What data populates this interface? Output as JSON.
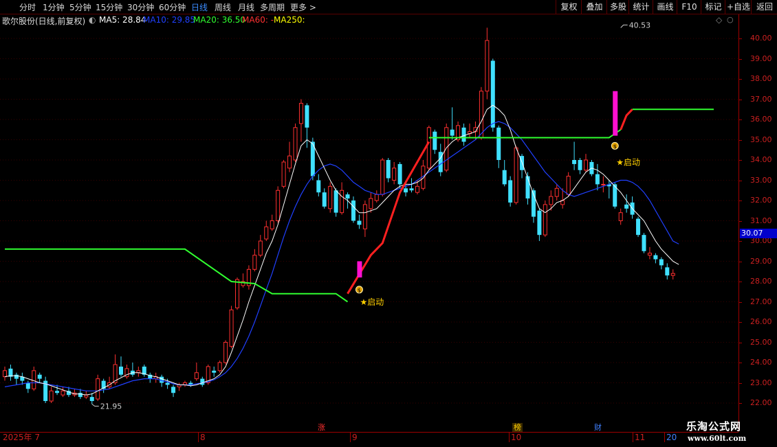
{
  "toolbar": {
    "periods": [
      "分时",
      "1分钟",
      "5分钟",
      "15分钟",
      "30分钟",
      "60分钟",
      "日线",
      "周线",
      "月线",
      "多周期",
      "更多 >"
    ],
    "active_period": "日线",
    "right_buttons": [
      "复权",
      "叠加",
      "多股",
      "统计",
      "画线",
      "F10",
      "标记",
      "+自选",
      "返回"
    ]
  },
  "stock_info": {
    "title": "歌尔股份(日线,前复权)",
    "ma5": "MA5: 28.84",
    "ma10": "MA10: 29.85",
    "ma20": "MA20: 36.50",
    "ma60": "MA60: -",
    "ma250": "MA250:"
  },
  "colors": {
    "up": "#ff3030",
    "down": "#40e0ff",
    "ma5": "#ffffff",
    "ma10": "#2040ff",
    "ma20": "#30ff30",
    "ma60": "#ff2020",
    "ma250": "#ffff00",
    "axis": "#cc2020",
    "price_tag": "#0000cc"
  },
  "price_axis": {
    "ticks": [
      "40.00",
      "39.00",
      "38.00",
      "37.00",
      "36.00",
      "35.00",
      "34.00",
      "33.00",
      "32.00",
      "31.00",
      "30.00",
      "29.00",
      "28.00",
      "27.00",
      "26.00",
      "25.00",
      "24.00",
      "23.00",
      "22.00"
    ],
    "current_price": "30.07"
  },
  "date_axis": {
    "labels": [
      "2025年 7",
      "8",
      "9",
      "10",
      "11",
      "20"
    ],
    "markers": [
      {
        "text": "涨",
        "color": "#ff3030"
      },
      {
        "text": "榜",
        "color": "#ffd000"
      },
      {
        "text": "财",
        "color": "#4080ff"
      }
    ]
  },
  "annotations": {
    "high_label": "40.53",
    "low_label": "21.95",
    "signal_label": "★启动",
    "signal_label_2": "★启动"
  },
  "watermark": {
    "line1": "乐淘公式网",
    "line2": "www.60lt.com"
  },
  "chart_data": {
    "type": "candlestick",
    "ylim": [
      21.5,
      41.2
    ],
    "candles": [
      {
        "o": 23.3,
        "c": 23.6,
        "h": 23.8,
        "l": 23.1
      },
      {
        "o": 23.7,
        "c": 23.3,
        "h": 23.9,
        "l": 23.1
      },
      {
        "o": 23.4,
        "c": 23.2,
        "h": 23.5,
        "l": 22.9
      },
      {
        "o": 23.3,
        "c": 23.1,
        "h": 23.5,
        "l": 22.9
      },
      {
        "o": 23.0,
        "c": 22.7,
        "h": 23.1,
        "l": 22.5
      },
      {
        "o": 22.7,
        "c": 23.6,
        "h": 23.8,
        "l": 22.6
      },
      {
        "o": 23.4,
        "c": 23.2,
        "h": 23.5,
        "l": 23.0
      },
      {
        "o": 23.1,
        "c": 22.1,
        "h": 23.3,
        "l": 22.0
      },
      {
        "o": 22.1,
        "c": 22.6,
        "h": 22.8,
        "l": 22.0
      },
      {
        "o": 22.6,
        "c": 22.5,
        "h": 22.9,
        "l": 22.4
      },
      {
        "o": 22.4,
        "c": 22.6,
        "h": 22.8,
        "l": 22.3
      },
      {
        "o": 22.6,
        "c": 22.4,
        "h": 22.8,
        "l": 22.3
      },
      {
        "o": 22.4,
        "c": 22.5,
        "h": 22.7,
        "l": 22.3
      },
      {
        "o": 22.5,
        "c": 22.3,
        "h": 22.7,
        "l": 22.2
      },
      {
        "o": 22.3,
        "c": 22.4,
        "h": 22.6,
        "l": 22.2
      },
      {
        "o": 22.3,
        "c": 22.1,
        "h": 22.5,
        "l": 21.95
      },
      {
        "o": 22.2,
        "c": 23.2,
        "h": 23.4,
        "l": 22.1
      },
      {
        "o": 23.1,
        "c": 22.7,
        "h": 23.2,
        "l": 22.5
      },
      {
        "o": 22.8,
        "c": 23.0,
        "h": 23.3,
        "l": 22.7
      },
      {
        "o": 23.0,
        "c": 23.9,
        "h": 24.4,
        "l": 22.9
      },
      {
        "o": 23.8,
        "c": 23.4,
        "h": 24.3,
        "l": 23.3
      },
      {
        "o": 23.3,
        "c": 23.7,
        "h": 23.9,
        "l": 23.2
      },
      {
        "o": 23.6,
        "c": 23.4,
        "h": 24.0,
        "l": 23.3
      },
      {
        "o": 23.5,
        "c": 23.6,
        "h": 23.8,
        "l": 23.3
      },
      {
        "o": 23.8,
        "c": 23.4,
        "h": 23.9,
        "l": 23.3
      },
      {
        "o": 23.4,
        "c": 23.2,
        "h": 23.5,
        "l": 23.0
      },
      {
        "o": 23.2,
        "c": 23.3,
        "h": 23.5,
        "l": 23.0
      },
      {
        "o": 23.3,
        "c": 23.0,
        "h": 23.4,
        "l": 22.8
      },
      {
        "o": 23.0,
        "c": 22.9,
        "h": 23.2,
        "l": 22.7
      },
      {
        "o": 22.8,
        "c": 22.5,
        "h": 22.9,
        "l": 22.3
      },
      {
        "o": 22.8,
        "c": 22.9,
        "h": 23.0,
        "l": 22.6
      },
      {
        "o": 22.9,
        "c": 23.0,
        "h": 23.1,
        "l": 22.8
      },
      {
        "o": 23.0,
        "c": 22.9,
        "h": 23.1,
        "l": 22.8
      },
      {
        "o": 23.2,
        "c": 23.5,
        "h": 24.0,
        "l": 23.1
      },
      {
        "o": 23.2,
        "c": 22.9,
        "h": 23.3,
        "l": 22.8
      },
      {
        "o": 23.0,
        "c": 23.8,
        "h": 23.9,
        "l": 22.9
      },
      {
        "o": 23.6,
        "c": 23.5,
        "h": 23.8,
        "l": 23.3
      },
      {
        "o": 23.6,
        "c": 24.0,
        "h": 24.1,
        "l": 23.5
      },
      {
        "o": 24.0,
        "c": 25.0,
        "h": 25.1,
        "l": 23.9
      },
      {
        "o": 24.8,
        "c": 26.6,
        "h": 26.8,
        "l": 24.7
      },
      {
        "o": 26.7,
        "c": 28.1,
        "h": 28.2,
        "l": 26.6
      },
      {
        "o": 27.8,
        "c": 28.0,
        "h": 28.4,
        "l": 27.7
      },
      {
        "o": 27.8,
        "c": 28.6,
        "h": 28.8,
        "l": 27.6
      },
      {
        "o": 28.6,
        "c": 29.3,
        "h": 29.6,
        "l": 28.5
      },
      {
        "o": 29.3,
        "c": 30.0,
        "h": 30.3,
        "l": 29.2
      },
      {
        "o": 30.1,
        "c": 30.7,
        "h": 31.0,
        "l": 30.0
      },
      {
        "o": 30.6,
        "c": 31.0,
        "h": 31.3,
        "l": 30.5
      },
      {
        "o": 31.0,
        "c": 32.5,
        "h": 32.7,
        "l": 30.9
      },
      {
        "o": 32.7,
        "c": 33.9,
        "h": 34.0,
        "l": 32.6
      },
      {
        "o": 33.6,
        "c": 34.2,
        "h": 34.9,
        "l": 33.4
      },
      {
        "o": 34.0,
        "c": 35.6,
        "h": 35.8,
        "l": 33.9
      },
      {
        "o": 35.8,
        "c": 36.8,
        "h": 37.0,
        "l": 34.9
      },
      {
        "o": 36.7,
        "c": 35.6,
        "h": 36.8,
        "l": 34.6
      },
      {
        "o": 34.9,
        "c": 33.2,
        "h": 35.1,
        "l": 33.0
      },
      {
        "o": 33.0,
        "c": 32.4,
        "h": 33.3,
        "l": 32.2
      },
      {
        "o": 32.4,
        "c": 31.7,
        "h": 32.6,
        "l": 31.6
      },
      {
        "o": 31.6,
        "c": 32.7,
        "h": 32.9,
        "l": 31.4
      },
      {
        "o": 32.5,
        "c": 31.4,
        "h": 32.6,
        "l": 31.2
      },
      {
        "o": 31.4,
        "c": 32.5,
        "h": 32.9,
        "l": 31.3
      },
      {
        "o": 32.3,
        "c": 32.1,
        "h": 32.4,
        "l": 31.6
      },
      {
        "o": 32.0,
        "c": 31.0,
        "h": 32.2,
        "l": 30.9
      },
      {
        "o": 31.0,
        "c": 30.8,
        "h": 31.3,
        "l": 30.6
      },
      {
        "o": 30.6,
        "c": 31.8,
        "h": 32.0,
        "l": 30.2
      },
      {
        "o": 31.6,
        "c": 32.1,
        "h": 32.4,
        "l": 31.4
      },
      {
        "o": 32.0,
        "c": 32.3,
        "h": 32.5,
        "l": 31.9
      },
      {
        "o": 32.3,
        "c": 34.0,
        "h": 34.1,
        "l": 32.2
      },
      {
        "o": 34.0,
        "c": 33.1,
        "h": 34.1,
        "l": 32.9
      },
      {
        "o": 33.0,
        "c": 33.6,
        "h": 33.9,
        "l": 32.8
      },
      {
        "o": 33.8,
        "c": 32.8,
        "h": 33.9,
        "l": 32.6
      },
      {
        "o": 32.6,
        "c": 32.4,
        "h": 32.9,
        "l": 32.2
      },
      {
        "o": 32.6,
        "c": 32.5,
        "h": 33.1,
        "l": 32.4
      },
      {
        "o": 32.4,
        "c": 32.7,
        "h": 33.0,
        "l": 32.3
      },
      {
        "o": 32.6,
        "c": 33.7,
        "h": 34.0,
        "l": 32.5
      },
      {
        "o": 33.6,
        "c": 35.6,
        "h": 35.7,
        "l": 33.5
      },
      {
        "o": 35.4,
        "c": 34.5,
        "h": 35.5,
        "l": 34.3
      },
      {
        "o": 34.4,
        "c": 33.4,
        "h": 34.8,
        "l": 33.2
      },
      {
        "o": 33.5,
        "c": 35.6,
        "h": 35.8,
        "l": 33.4
      },
      {
        "o": 35.5,
        "c": 35.2,
        "h": 36.6,
        "l": 35.0
      },
      {
        "o": 35.0,
        "c": 35.7,
        "h": 35.9,
        "l": 34.9
      },
      {
        "o": 35.6,
        "c": 34.9,
        "h": 35.8,
        "l": 34.7
      },
      {
        "o": 35.3,
        "c": 35.4,
        "h": 35.8,
        "l": 35.1
      },
      {
        "o": 35.4,
        "c": 35.6,
        "h": 35.9,
        "l": 35.0
      },
      {
        "o": 35.1,
        "c": 37.4,
        "h": 37.6,
        "l": 35.0
      },
      {
        "o": 37.4,
        "c": 39.9,
        "h": 40.53,
        "l": 37.0
      },
      {
        "o": 38.9,
        "c": 35.6,
        "h": 39.0,
        "l": 35.4
      },
      {
        "o": 35.6,
        "c": 34.0,
        "h": 35.7,
        "l": 33.6
      },
      {
        "o": 33.5,
        "c": 32.8,
        "h": 34.0,
        "l": 32.7
      },
      {
        "o": 33.0,
        "c": 31.9,
        "h": 33.2,
        "l": 31.7
      },
      {
        "o": 31.9,
        "c": 34.6,
        "h": 34.7,
        "l": 31.8
      },
      {
        "o": 34.2,
        "c": 33.5,
        "h": 34.3,
        "l": 33.1
      },
      {
        "o": 33.2,
        "c": 32.1,
        "h": 33.4,
        "l": 31.8
      },
      {
        "o": 32.5,
        "c": 31.2,
        "h": 32.6,
        "l": 30.9
      },
      {
        "o": 31.5,
        "c": 30.3,
        "h": 31.6,
        "l": 30.0
      },
      {
        "o": 30.3,
        "c": 31.8,
        "h": 32.0,
        "l": 30.2
      },
      {
        "o": 31.8,
        "c": 32.2,
        "h": 32.5,
        "l": 31.5
      },
      {
        "o": 32.2,
        "c": 32.6,
        "h": 32.8,
        "l": 32.0
      },
      {
        "o": 31.8,
        "c": 32.0,
        "h": 32.6,
        "l": 31.6
      },
      {
        "o": 32.3,
        "c": 33.2,
        "h": 33.4,
        "l": 32.2
      },
      {
        "o": 34.0,
        "c": 33.8,
        "h": 34.9,
        "l": 33.5
      },
      {
        "o": 34.0,
        "c": 33.5,
        "h": 34.1,
        "l": 33.3
      },
      {
        "o": 33.5,
        "c": 34.0,
        "h": 34.3,
        "l": 33.4
      },
      {
        "o": 33.9,
        "c": 33.3,
        "h": 34.0,
        "l": 33.2
      },
      {
        "o": 33.3,
        "c": 32.8,
        "h": 33.8,
        "l": 32.5
      },
      {
        "o": 32.8,
        "c": 32.8,
        "h": 33.2,
        "l": 32.4
      },
      {
        "o": 32.8,
        "c": 32.7,
        "h": 33.0,
        "l": 32.1
      },
      {
        "o": 32.8,
        "c": 31.7,
        "h": 32.9,
        "l": 31.6
      },
      {
        "o": 31.0,
        "c": 31.4,
        "h": 31.6,
        "l": 30.8
      },
      {
        "o": 31.8,
        "c": 31.6,
        "h": 32.3,
        "l": 31.4
      },
      {
        "o": 31.9,
        "c": 31.3,
        "h": 32.2,
        "l": 31.1
      },
      {
        "o": 31.1,
        "c": 30.3,
        "h": 31.2,
        "l": 30.2
      },
      {
        "o": 30.3,
        "c": 29.5,
        "h": 30.4,
        "l": 29.4
      },
      {
        "o": 29.3,
        "c": 29.4,
        "h": 29.7,
        "l": 29.1
      },
      {
        "o": 29.3,
        "c": 29.1,
        "h": 29.4,
        "l": 28.9
      },
      {
        "o": 29.1,
        "c": 28.8,
        "h": 29.2,
        "l": 28.6
      },
      {
        "o": 28.7,
        "c": 28.3,
        "h": 28.9,
        "l": 28.1
      },
      {
        "o": 28.3,
        "c": 28.4,
        "h": 28.6,
        "l": 28.1
      }
    ],
    "ma_white": [
      23.3,
      23.35,
      23.35,
      23.3,
      23.2,
      23.1,
      23.0,
      22.95,
      22.85,
      22.75,
      22.65,
      22.55,
      22.45,
      22.45,
      22.4,
      22.45,
      22.6,
      22.75,
      22.9,
      23.1,
      23.25,
      23.4,
      23.5,
      23.5,
      23.45,
      23.35,
      23.3,
      23.2,
      23.1,
      23.0,
      22.9,
      22.9,
      22.85,
      22.9,
      23.0,
      23.1,
      23.2,
      23.4,
      23.8,
      24.5,
      25.3,
      26.1,
      27.0,
      27.8,
      28.6,
      29.4,
      30.0,
      30.8,
      31.8,
      32.8,
      33.8,
      34.7,
      35.0,
      34.8,
      34.2,
      33.6,
      33.0,
      32.5,
      32.2,
      32.0,
      31.7,
      31.4,
      31.4,
      31.5,
      31.6,
      31.9,
      32.2,
      32.5,
      32.7,
      32.8,
      32.8,
      32.9,
      33.1,
      33.5,
      33.8,
      34.1,
      34.6,
      34.9,
      35.1,
      35.2,
      35.3,
      35.4,
      35.9,
      36.5,
      36.7,
      36.5,
      36.2,
      35.5,
      34.6,
      33.9,
      33.1,
      32.3,
      31.6,
      31.4,
      31.6,
      31.9,
      32.0,
      32.2,
      32.6,
      33.0,
      33.4,
      33.6,
      33.5,
      33.3,
      33.0,
      32.7,
      32.4,
      32.0,
      31.6,
      31.3,
      31.0,
      30.5,
      30.0,
      29.6,
      29.3,
      29.0,
      28.84
    ],
    "ma_blue": [
      22.8,
      22.85,
      22.9,
      22.95,
      23.0,
      23.0,
      23.0,
      22.95,
      22.9,
      22.85,
      22.8,
      22.75,
      22.7,
      22.65,
      22.6,
      22.6,
      22.6,
      22.65,
      22.7,
      22.8,
      22.9,
      23.0,
      23.1,
      23.15,
      23.2,
      23.2,
      23.2,
      23.1,
      23.05,
      22.95,
      22.9,
      22.9,
      22.9,
      22.95,
      23.0,
      23.05,
      23.15,
      23.3,
      23.5,
      23.8,
      24.2,
      24.7,
      25.3,
      26.0,
      26.8,
      27.6,
      28.4,
      29.3,
      30.2,
      31.0,
      31.7,
      32.3,
      32.8,
      33.2,
      33.5,
      33.7,
      33.8,
      33.7,
      33.5,
      33.2,
      32.9,
      32.7,
      32.5,
      32.4,
      32.3,
      32.3,
      32.4,
      32.5,
      32.6,
      32.7,
      32.8,
      33.0,
      33.2,
      33.4,
      33.6,
      33.8,
      34.0,
      34.2,
      34.4,
      34.6,
      34.8,
      35.0,
      35.3,
      35.6,
      35.8,
      35.9,
      35.8,
      35.6,
      35.3,
      35.0,
      34.6,
      34.2,
      33.8,
      33.4,
      33.1,
      32.8,
      32.5,
      32.3,
      32.2,
      32.3,
      32.4,
      32.5,
      32.6,
      32.7,
      32.8,
      32.9,
      33.0,
      33.0,
      32.9,
      32.7,
      32.4,
      32.0,
      31.5,
      31.0,
      30.5,
      30.0,
      29.85
    ],
    "signal_line": {
      "flat": [
        {
          "i": 0,
          "v": 29.6
        },
        {
          "i": 31,
          "v": 29.6
        },
        {
          "i": 39,
          "v": 28.0
        },
        {
          "i": 43,
          "v": 27.9
        },
        {
          "i": 46,
          "v": 27.4
        },
        {
          "i": 57,
          "v": 27.4
        },
        {
          "i": 59,
          "v": 27.0
        }
      ],
      "rise": [
        {
          "i": 59,
          "v": 27.4
        },
        {
          "i": 63,
          "v": 29.3
        },
        {
          "i": 65,
          "v": 29.9
        },
        {
          "i": 68,
          "v": 32.4
        },
        {
          "i": 73,
          "v": 34.9
        }
      ],
      "top": [
        {
          "i": 73,
          "v": 35.1
        },
        {
          "i": 104,
          "v": 35.1
        },
        {
          "i": 106,
          "v": 35.5
        }
      ],
      "rise2": [
        {
          "i": 106,
          "v": 35.5
        },
        {
          "i": 107,
          "v": 36.2
        },
        {
          "i": 108,
          "v": 36.5
        }
      ],
      "top2": [
        {
          "i": 108,
          "v": 36.5
        },
        {
          "i": 150,
          "v": 36.5
        }
      ]
    },
    "signal_bars": [
      {
        "i": 61,
        "o": 28.2,
        "c": 29.0
      },
      {
        "i": 105,
        "o": 35.2,
        "c": 37.4
      }
    ],
    "signal_icons": [
      {
        "i": 61,
        "v": 27.6
      },
      {
        "i": 105,
        "v": 34.7
      }
    ]
  }
}
